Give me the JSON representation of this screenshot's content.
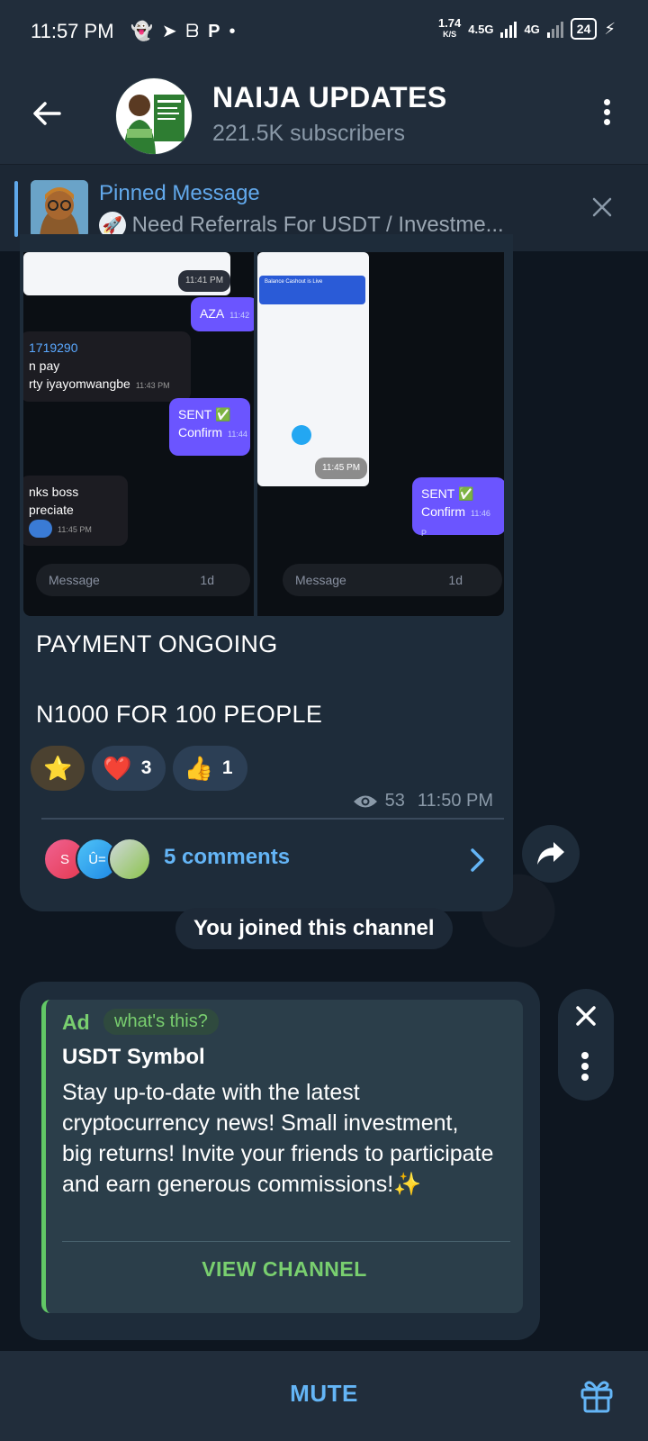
{
  "status_bar": {
    "time": "11:57 PM",
    "speed_value": "1.74",
    "speed_unit": "K/S",
    "network_1": "4.5G",
    "network_2": "4G",
    "battery": "24"
  },
  "header": {
    "title": "NAIJA UPDATES",
    "subtitle": "221.5K subscribers"
  },
  "pinned": {
    "title": "Pinned Message",
    "text": "Need Referrals For USDT / Investme..."
  },
  "message": {
    "screenshot_left": {
      "bubble_aza": "AZA",
      "bubble_aza_time": "11:42",
      "bubble_account_line1": "1719290",
      "bubble_account_line2": "n pay",
      "bubble_account_line3": "rty iyayomwangbe",
      "bubble_account_time": "11:43 PM",
      "bubble_sent_1": "SENT ✅",
      "bubble_sent_2": "Confirm",
      "bubble_sent_time": "11:44",
      "bubble_thanks_1": "nks boss",
      "bubble_thanks_2": "preciate",
      "bubble_thanks_time": "11:45 PM",
      "phone_time": "11:41 PM",
      "input_placeholder": "Message",
      "input_timer": "1d"
    },
    "screenshot_right": {
      "phone_time": "11:45 PM",
      "phone_banner": "Balance Cashout is Live",
      "bubble_sent_1": "SENT ✅",
      "bubble_sent_2": "Confirm",
      "bubble_sent_time": "11:46 P",
      "input_placeholder": "Message",
      "input_timer": "1d"
    },
    "caption_line1": "PAYMENT ONGOING",
    "caption_line2": "N1000 FOR 100 PEOPLE",
    "reactions": [
      {
        "emoji": "⭐",
        "count": ""
      },
      {
        "emoji": "❤️",
        "count": "3"
      },
      {
        "emoji": "👍",
        "count": "1"
      }
    ],
    "views": "53",
    "time": "11:50 PM",
    "comments_label": "5 comments",
    "commenter_avatars": [
      "S",
      "Û="
    ]
  },
  "service_message": "You joined this channel",
  "ad": {
    "tag": "Ad",
    "whats_this": "what's this?",
    "title": "USDT Symbol",
    "body": "Stay up-to-date with the latest cryptocurrency news! Small investment, big returns! Invite your friends to participate and earn generous commissions!✨",
    "cta": "VIEW CHANNEL"
  },
  "bottom_bar": {
    "mute_label": "MUTE"
  },
  "colors": {
    "accent": "#64b5f6",
    "ad_green": "#79cf6f",
    "header_bg": "#212d3b",
    "bubble_bg": "#1e2c3a"
  }
}
